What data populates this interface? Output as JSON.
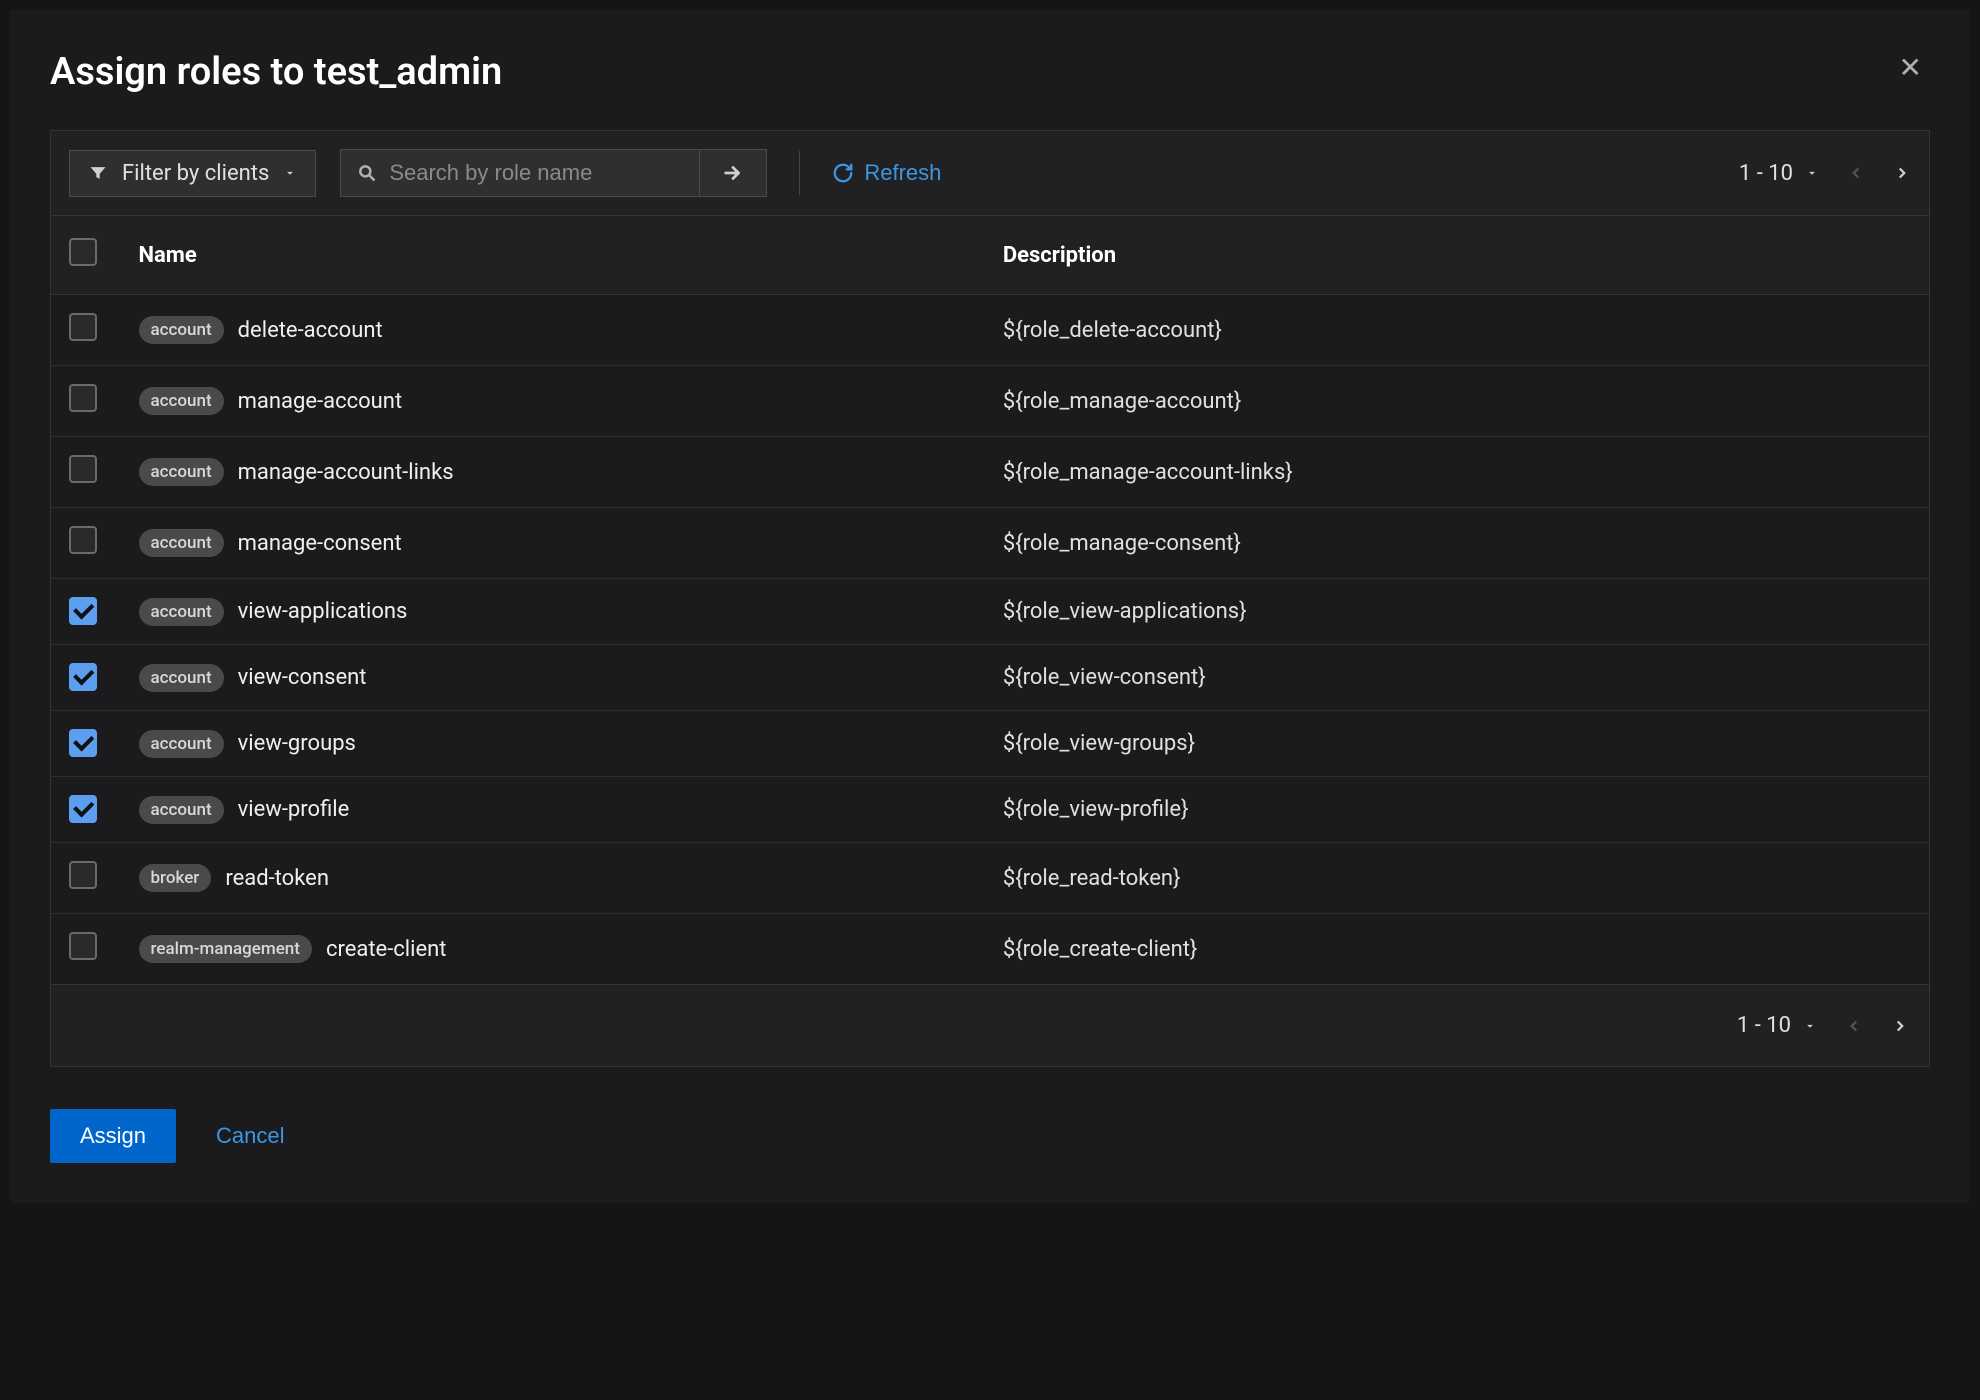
{
  "modal": {
    "title": "Assign roles to test_admin"
  },
  "toolbar": {
    "filter_label": "Filter by clients",
    "search_placeholder": "Search by role name",
    "refresh_label": "Refresh"
  },
  "pagination": {
    "range": "1 - 10"
  },
  "columns": {
    "name": "Name",
    "description": "Description"
  },
  "rows": [
    {
      "checked": false,
      "client": "account",
      "name": "delete-account",
      "description": "${role_delete-account}"
    },
    {
      "checked": false,
      "client": "account",
      "name": "manage-account",
      "description": "${role_manage-account}"
    },
    {
      "checked": false,
      "client": "account",
      "name": "manage-account-links",
      "description": "${role_manage-account-links}"
    },
    {
      "checked": false,
      "client": "account",
      "name": "manage-consent",
      "description": "${role_manage-consent}"
    },
    {
      "checked": true,
      "client": "account",
      "name": "view-applications",
      "description": "${role_view-applications}"
    },
    {
      "checked": true,
      "client": "account",
      "name": "view-consent",
      "description": "${role_view-consent}"
    },
    {
      "checked": true,
      "client": "account",
      "name": "view-groups",
      "description": "${role_view-groups}"
    },
    {
      "checked": true,
      "client": "account",
      "name": "view-profile",
      "description": "${role_view-profile}"
    },
    {
      "checked": false,
      "client": "broker",
      "name": "read-token",
      "description": "${role_read-token}"
    },
    {
      "checked": false,
      "client": "realm-management",
      "name": "create-client",
      "description": "${role_create-client}"
    }
  ],
  "footer": {
    "assign": "Assign",
    "cancel": "Cancel"
  }
}
